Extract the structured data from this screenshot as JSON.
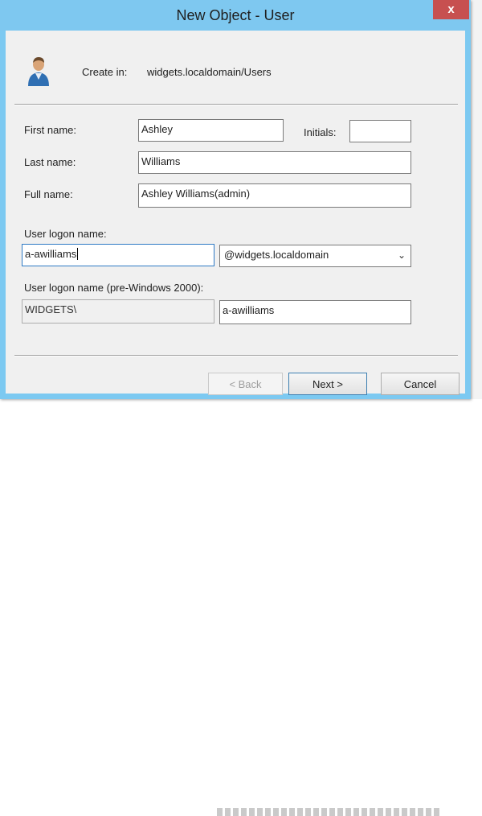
{
  "window": {
    "title": "New Object - User",
    "close_label": "x"
  },
  "header": {
    "create_in_label": "Create in:",
    "create_in_value": "widgets.localdomain/Users"
  },
  "form": {
    "first_name_label": "First name:",
    "first_name_value": "Ashley",
    "initials_label": "Initials:",
    "initials_value": "",
    "last_name_label": "Last name:",
    "last_name_value": "Williams",
    "full_name_label": "Full name:",
    "full_name_value": "Ashley Williams(admin)",
    "logon_name_label": "User logon name:",
    "logon_name_value": "a-awilliams",
    "domain_selected": "@widgets.localdomain",
    "pre2000_label": "User logon name (pre-Windows 2000):",
    "pre2000_domain": "WIDGETS\\",
    "pre2000_user": "a-awilliams"
  },
  "buttons": {
    "back": "< Back",
    "next": "Next >",
    "cancel": "Cancel"
  },
  "icons": {
    "user": "user-icon",
    "dropdown": "chevron-down-icon"
  },
  "colors": {
    "titlebar": "#7ec8f0",
    "close": "#c75050",
    "client": "#f0f0f0",
    "focus": "#2f7ac5"
  }
}
